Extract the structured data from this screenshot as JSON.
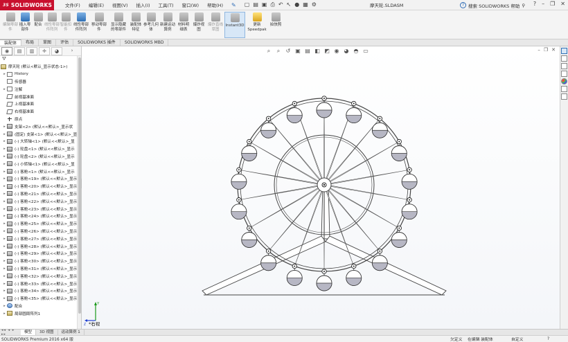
{
  "app": {
    "logo_text": "SOLIDWORKS",
    "document_title": "摩天轮.SLDASM",
    "menu": [
      "文件(F)",
      "编辑(E)",
      "视图(V)",
      "插入(I)",
      "工具(T)",
      "窗口(W)",
      "帮助(H)"
    ],
    "search_placeholder": "搜索 SOLIDWORKS 帮助"
  },
  "ribbon": {
    "buttons": [
      {
        "label": "编辑零部件",
        "disabled": true
      },
      {
        "label": "插入零部件",
        "disabled": false
      },
      {
        "label": "配合",
        "disabled": false
      },
      {
        "label": "线性零部件阵列",
        "disabled": true
      },
      {
        "label": "智能扣件",
        "disabled": true
      },
      {
        "label": "线性零部件阵列",
        "disabled": false
      },
      {
        "label": "移动零部件",
        "disabled": false
      },
      {
        "label": "显示隐藏的零部件",
        "disabled": false
      },
      {
        "label": "装配体特征",
        "disabled": false
      },
      {
        "label": "参考几何体",
        "disabled": false
      },
      {
        "label": "新建运动算例",
        "disabled": false
      },
      {
        "label": "材料明细表",
        "disabled": false
      },
      {
        "label": "爆炸视图",
        "disabled": false
      },
      {
        "label": "爆炸直线草图",
        "disabled": true
      },
      {
        "label": "Instant3D",
        "disabled": false
      },
      {
        "label": "更新Speedpak",
        "disabled": false
      },
      {
        "label": "拍快照",
        "disabled": false
      }
    ]
  },
  "tabs": [
    "装配体",
    "布局",
    "草图",
    "评估",
    "SOLIDWORKS 插件",
    "SOLIDWORKS MBD"
  ],
  "feature_tree": {
    "root": "摩天轮 (默认<默认_显示状态-1>)",
    "items": [
      {
        "label": "History",
        "icon": "folder",
        "expand": "▸"
      },
      {
        "label": "传感器",
        "icon": "sensor",
        "expand": ""
      },
      {
        "label": "注解",
        "icon": "annotation",
        "expand": "▸"
      },
      {
        "label": "前视基准面",
        "icon": "plane",
        "expand": ""
      },
      {
        "label": "上视基准面",
        "icon": "plane",
        "expand": ""
      },
      {
        "label": "右视基准面",
        "icon": "plane",
        "expand": ""
      },
      {
        "label": "原点",
        "icon": "origin",
        "expand": ""
      },
      {
        "label": "支架<2> (默认<<默认>_显示状",
        "icon": "part",
        "expand": "▸"
      },
      {
        "label": "(固定) 支架<1> (默认<<默认>_显",
        "icon": "part",
        "expand": "▸"
      },
      {
        "label": "(-) 大转轴<1> (默认<<默认>_显",
        "icon": "part",
        "expand": "▸"
      },
      {
        "label": "(-) 轮盘<1> (默认<<默认>_显示",
        "icon": "part",
        "expand": "▸"
      },
      {
        "label": "(-) 轮盘<2> (默认<<默认>_显示",
        "icon": "part",
        "expand": "▸"
      },
      {
        "label": "(-) 小转轴<1> (默认<<默认>_显",
        "icon": "part",
        "expand": "▸"
      },
      {
        "label": "(-) 客舱<1> (默认<<默认>_显示",
        "icon": "part",
        "expand": "▸"
      },
      {
        "label": "(-) 客舱<19> (默认<<默认>_显示",
        "icon": "part",
        "expand": "▸"
      },
      {
        "label": "(-) 客舱<20> (默认<<默认>_显示",
        "icon": "part",
        "expand": "▸"
      },
      {
        "label": "(-) 客舱<21> (默认<<默认>_显示",
        "icon": "part",
        "expand": "▸"
      },
      {
        "label": "(-) 客舱<22> (默认<<默认>_显示",
        "icon": "part",
        "expand": "▸"
      },
      {
        "label": "(-) 客舱<23> (默认<<默认>_显示",
        "icon": "part",
        "expand": "▸"
      },
      {
        "label": "(-) 客舱<24> (默认<<默认>_显示",
        "icon": "part",
        "expand": "▸"
      },
      {
        "label": "(-) 客舱<25> (默认<<默认>_显示",
        "icon": "part",
        "expand": "▸"
      },
      {
        "label": "(-) 客舱<26> (默认<<默认>_显示",
        "icon": "part",
        "expand": "▸"
      },
      {
        "label": "(-) 客舱<27> (默认<<默认>_显示",
        "icon": "part",
        "expand": "▸"
      },
      {
        "label": "(-) 客舱<28> (默认<<默认>_显示",
        "icon": "part",
        "expand": "▸"
      },
      {
        "label": "(-) 客舱<29> (默认<<默认>_显示",
        "icon": "part",
        "expand": "▸"
      },
      {
        "label": "(-) 客舱<30> (默认<<默认>_显示",
        "icon": "part",
        "expand": "▸"
      },
      {
        "label": "(-) 客舱<31> (默认<<默认>_显示",
        "icon": "part",
        "expand": "▸"
      },
      {
        "label": "(-) 客舱<32> (默认<<默认>_显示",
        "icon": "part",
        "expand": "▸"
      },
      {
        "label": "(-) 客舱<33> (默认<<默认>_显示",
        "icon": "part",
        "expand": "▸"
      },
      {
        "label": "(-) 客舱<34> (默认<<默认>_显示",
        "icon": "part",
        "expand": "▸"
      },
      {
        "label": "(-) 客舱<35> (默认<<默认>_显示",
        "icon": "part",
        "expand": "▸"
      },
      {
        "label": "配合",
        "icon": "mate",
        "expand": "▸"
      },
      {
        "label": "局部圆周阵列1",
        "icon": "asm",
        "expand": "▸"
      }
    ]
  },
  "viewport": {
    "view_name": "*右视"
  },
  "bottom_tabs": [
    "模型",
    "3D 视图",
    "运动算例 1"
  ],
  "status": {
    "version": "SOLIDWORKS Premium 2016 x64 版",
    "state1": "欠定义",
    "state2": "在编辑 装配体",
    "state3": "自定义",
    "state4": "?"
  },
  "colors": {
    "brand": "#c8102e",
    "accent": "#2e6fb5",
    "cabin_fill": "#b7b7c4"
  }
}
